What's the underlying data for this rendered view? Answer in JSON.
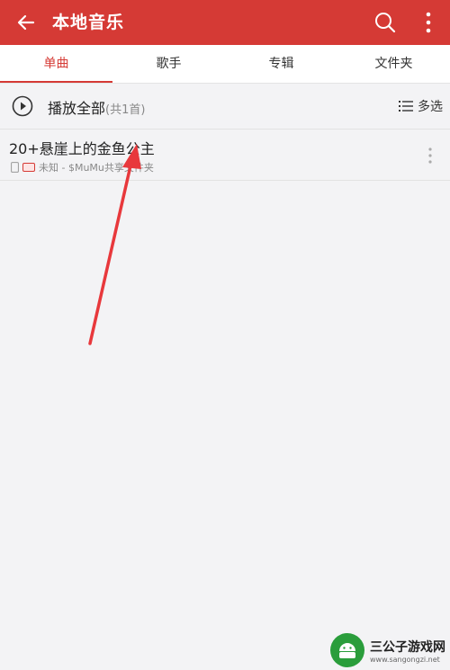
{
  "appbar": {
    "title": "本地音乐",
    "back_icon": "back-arrow-icon",
    "search_icon": "search-icon",
    "more_icon": "more-vertical-icon",
    "color": "#d53a35"
  },
  "tabs": [
    {
      "label": "单曲",
      "active": true
    },
    {
      "label": "歌手",
      "active": false
    },
    {
      "label": "专辑",
      "active": false
    },
    {
      "label": "文件夹",
      "active": false
    }
  ],
  "play_all": {
    "label": "播放全部",
    "count": "(共1首)",
    "multi_select": "多选"
  },
  "songs": [
    {
      "title": "20+悬崖上的金鱼公主",
      "meta": "未知 - $MuMu共享文件夹"
    }
  ],
  "watermark": {
    "name": "三公子游戏网",
    "url": "www.sangongzi.net"
  }
}
